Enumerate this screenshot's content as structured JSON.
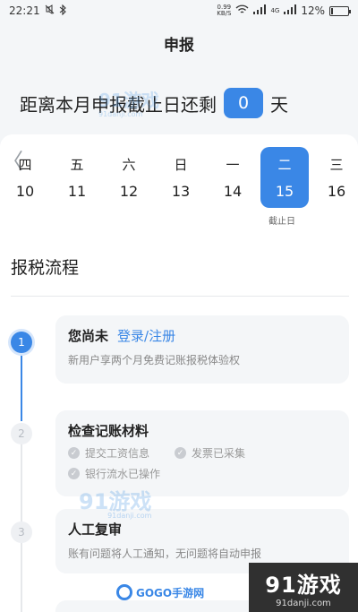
{
  "status_bar": {
    "time": "22:21",
    "net_speed_value": "0.99",
    "net_speed_unit": "KB/S",
    "network": "4G",
    "battery": "12%",
    "battery_level": 0.12,
    "icons": [
      "mute-icon",
      "bluetooth-icon",
      "wifi-icon",
      "signal-icon",
      "battery-icon"
    ]
  },
  "nav": {
    "title": "申报"
  },
  "countdown": {
    "prefix": "距离本月申报截止日还剩",
    "days": "0",
    "suffix": "天"
  },
  "calendar": {
    "days": [
      {
        "weekday": "四",
        "date": "10"
      },
      {
        "weekday": "五",
        "date": "11"
      },
      {
        "weekday": "六",
        "date": "12"
      },
      {
        "weekday": "日",
        "date": "13"
      },
      {
        "weekday": "一",
        "date": "14"
      },
      {
        "weekday": "二",
        "date": "15"
      },
      {
        "weekday": "三",
        "date": "16"
      }
    ],
    "active_index": 5,
    "deadline_label": "截止日"
  },
  "process": {
    "title": "报税流程",
    "steps": [
      {
        "num": "1",
        "title": "您尚未",
        "link": "登录/注册",
        "subtitle": "新用户享两个月免费记账报税体验权"
      },
      {
        "num": "2",
        "title": "检查记账材料",
        "checks": [
          "提交工资信息",
          "发票已采集",
          "银行流水已操作"
        ]
      },
      {
        "num": "3",
        "title": "人工复审",
        "subtitle": "账有问题将人工通知，无问题将自动申报"
      }
    ]
  },
  "watermarks": {
    "site_main": "91游戏",
    "site_domain": "91danji.com",
    "gogo": "GOGO手游网",
    "corner_big": "91游戏",
    "corner_small": "91danji.com"
  },
  "colors": {
    "accent": "#3a87e6",
    "background": "#f4f6f8",
    "card": "#f4f6f8"
  }
}
